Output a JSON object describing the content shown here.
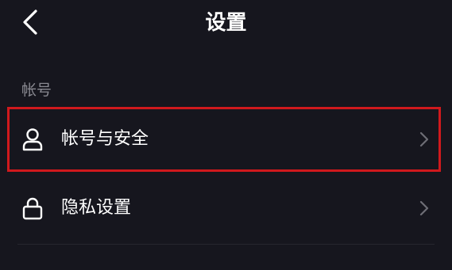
{
  "header": {
    "title": "设置",
    "back_icon": "chevron-left-icon"
  },
  "section": {
    "title": "帐号"
  },
  "items": [
    {
      "label": "帐号与安全",
      "icon": "user-icon",
      "highlighted": true
    },
    {
      "label": "隐私设置",
      "icon": "lock-icon",
      "highlighted": false
    }
  ],
  "colors": {
    "background": "#16161e",
    "text": "#ffffff",
    "section_text": "#8a8a92",
    "chevron": "#6e6e76",
    "highlight_border": "#d0191d"
  }
}
